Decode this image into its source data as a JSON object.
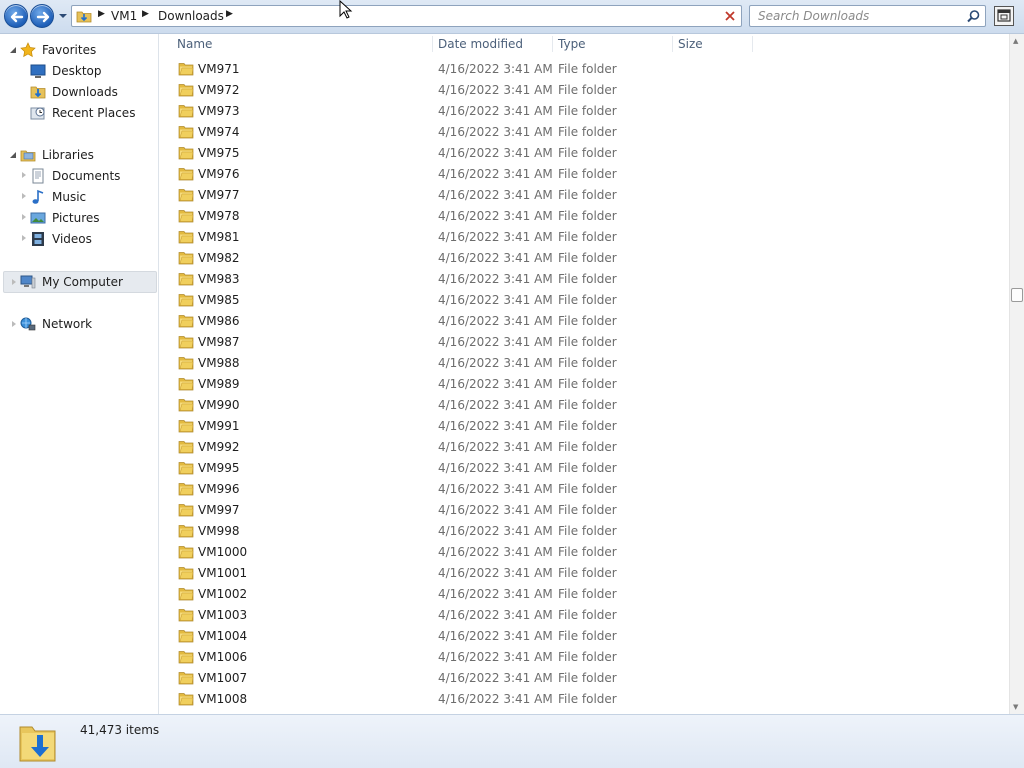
{
  "toolbar": {
    "back_label": "Back",
    "forward_label": "Forward"
  },
  "address": {
    "crumbs": [
      "VM1",
      "Downloads"
    ]
  },
  "search": {
    "placeholder": "Search Downloads"
  },
  "nav": {
    "favorites": {
      "label": "Favorites",
      "items": [
        "Desktop",
        "Downloads",
        "Recent Places"
      ]
    },
    "libraries": {
      "label": "Libraries",
      "items": [
        "Documents",
        "Music",
        "Pictures",
        "Videos"
      ]
    },
    "computer": {
      "label": "My Computer"
    },
    "network": {
      "label": "Network"
    }
  },
  "columns": {
    "name": "Name",
    "date": "Date modified",
    "type": "Type",
    "size": "Size"
  },
  "files": [
    {
      "name": "VM971",
      "date": "4/16/2022 3:41 AM",
      "type": "File folder"
    },
    {
      "name": "VM972",
      "date": "4/16/2022 3:41 AM",
      "type": "File folder"
    },
    {
      "name": "VM973",
      "date": "4/16/2022 3:41 AM",
      "type": "File folder"
    },
    {
      "name": "VM974",
      "date": "4/16/2022 3:41 AM",
      "type": "File folder"
    },
    {
      "name": "VM975",
      "date": "4/16/2022 3:41 AM",
      "type": "File folder"
    },
    {
      "name": "VM976",
      "date": "4/16/2022 3:41 AM",
      "type": "File folder"
    },
    {
      "name": "VM977",
      "date": "4/16/2022 3:41 AM",
      "type": "File folder"
    },
    {
      "name": "VM978",
      "date": "4/16/2022 3:41 AM",
      "type": "File folder"
    },
    {
      "name": "VM981",
      "date": "4/16/2022 3:41 AM",
      "type": "File folder"
    },
    {
      "name": "VM982",
      "date": "4/16/2022 3:41 AM",
      "type": "File folder"
    },
    {
      "name": "VM983",
      "date": "4/16/2022 3:41 AM",
      "type": "File folder"
    },
    {
      "name": "VM985",
      "date": "4/16/2022 3:41 AM",
      "type": "File folder"
    },
    {
      "name": "VM986",
      "date": "4/16/2022 3:41 AM",
      "type": "File folder"
    },
    {
      "name": "VM987",
      "date": "4/16/2022 3:41 AM",
      "type": "File folder"
    },
    {
      "name": "VM988",
      "date": "4/16/2022 3:41 AM",
      "type": "File folder"
    },
    {
      "name": "VM989",
      "date": "4/16/2022 3:41 AM",
      "type": "File folder"
    },
    {
      "name": "VM990",
      "date": "4/16/2022 3:41 AM",
      "type": "File folder"
    },
    {
      "name": "VM991",
      "date": "4/16/2022 3:41 AM",
      "type": "File folder"
    },
    {
      "name": "VM992",
      "date": "4/16/2022 3:41 AM",
      "type": "File folder"
    },
    {
      "name": "VM995",
      "date": "4/16/2022 3:41 AM",
      "type": "File folder"
    },
    {
      "name": "VM996",
      "date": "4/16/2022 3:41 AM",
      "type": "File folder"
    },
    {
      "name": "VM997",
      "date": "4/16/2022 3:41 AM",
      "type": "File folder"
    },
    {
      "name": "VM998",
      "date": "4/16/2022 3:41 AM",
      "type": "File folder"
    },
    {
      "name": "VM1000",
      "date": "4/16/2022 3:41 AM",
      "type": "File folder"
    },
    {
      "name": "VM1001",
      "date": "4/16/2022 3:41 AM",
      "type": "File folder"
    },
    {
      "name": "VM1002",
      "date": "4/16/2022 3:41 AM",
      "type": "File folder"
    },
    {
      "name": "VM1003",
      "date": "4/16/2022 3:41 AM",
      "type": "File folder"
    },
    {
      "name": "VM1004",
      "date": "4/16/2022 3:41 AM",
      "type": "File folder"
    },
    {
      "name": "VM1006",
      "date": "4/16/2022 3:41 AM",
      "type": "File folder"
    },
    {
      "name": "VM1007",
      "date": "4/16/2022 3:41 AM",
      "type": "File folder"
    },
    {
      "name": "VM1008",
      "date": "4/16/2022 3:41 AM",
      "type": "File folder"
    }
  ],
  "status": {
    "item_count": "41,473 items"
  },
  "icons": {
    "back": "back-arrow-icon",
    "forward": "forward-arrow-icon",
    "refresh": "close-x-icon",
    "search": "search-icon",
    "folder": "folder-icon"
  },
  "colors": {
    "accent": "#1f5fb8",
    "selection": "#e6eaef",
    "header_text": "#4c607a",
    "muted_text": "#6d6d6d"
  }
}
